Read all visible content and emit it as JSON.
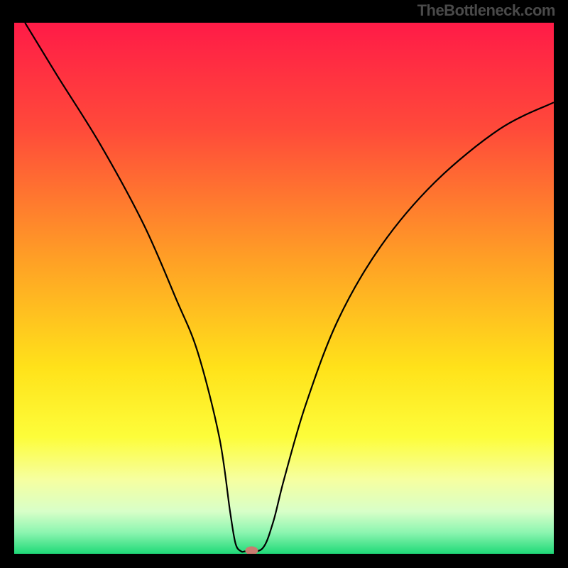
{
  "watermark": "TheBottleneck.com",
  "chart_data": {
    "type": "line",
    "title": "",
    "xlabel": "",
    "ylabel": "",
    "xlim": [
      0,
      100
    ],
    "ylim": [
      0,
      100
    ],
    "series": [
      {
        "name": "curve",
        "x": [
          2,
          8,
          16,
          24,
          30,
          34,
          38,
          40,
          41,
          42,
          43,
          46,
          48,
          50,
          54,
          60,
          68,
          78,
          90,
          100
        ],
        "y": [
          100,
          90,
          77,
          62,
          48,
          38,
          22,
          8,
          2,
          0.5,
          0.5,
          1,
          6,
          14,
          28,
          44,
          58,
          70,
          80,
          85
        ]
      }
    ],
    "marker": {
      "x": 44,
      "y": 0.6,
      "color": "#c97c70"
    },
    "gradient_stops": [
      {
        "pos": 0.0,
        "color": "#ff1b47"
      },
      {
        "pos": 0.2,
        "color": "#ff4a3a"
      },
      {
        "pos": 0.45,
        "color": "#ffa125"
      },
      {
        "pos": 0.65,
        "color": "#ffe21a"
      },
      {
        "pos": 0.78,
        "color": "#fdfd3a"
      },
      {
        "pos": 0.86,
        "color": "#f6ffa0"
      },
      {
        "pos": 0.92,
        "color": "#d8ffc8"
      },
      {
        "pos": 0.96,
        "color": "#8cf5b0"
      },
      {
        "pos": 1.0,
        "color": "#1fd977"
      }
    ]
  }
}
